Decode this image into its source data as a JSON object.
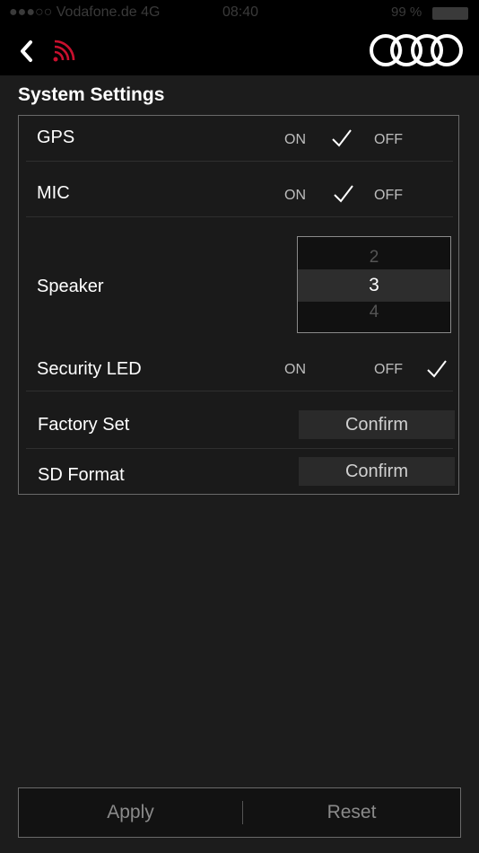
{
  "status_bar": {
    "carrier": "●●●○○ Vodafone.de  4G",
    "time": "08:40",
    "battery": "99 %"
  },
  "page": {
    "title": "System Settings"
  },
  "settings": {
    "gps": {
      "label": "GPS",
      "on": "ON",
      "off": "OFF",
      "selected": "on"
    },
    "mic": {
      "label": "MIC",
      "on": "ON",
      "off": "OFF",
      "selected": "on"
    },
    "speaker": {
      "label": "Speaker",
      "options": [
        "2",
        "3",
        "4"
      ],
      "selected": "3"
    },
    "security_led": {
      "label": "Security LED",
      "on": "ON",
      "off": "OFF",
      "selected": "off"
    },
    "factory_set": {
      "label": "Factory Set",
      "button": "Confirm"
    },
    "sd_format": {
      "label": "SD Format",
      "button": "Confirm"
    }
  },
  "footer": {
    "apply": "Apply",
    "reset": "Reset"
  },
  "icons": {
    "back": "chevron-left-icon",
    "signal": "wifi-signal-icon",
    "logo": "four-rings-logo",
    "check": "check-icon"
  },
  "colors": {
    "accent": "#c8102e",
    "background": "#1c1c1c",
    "bar": "#000000"
  }
}
